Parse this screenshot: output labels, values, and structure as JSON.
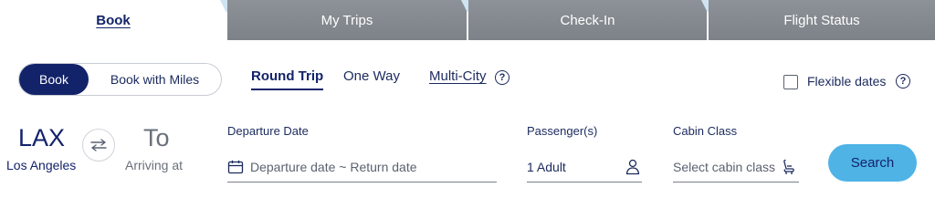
{
  "tabs": [
    {
      "label": "Book"
    },
    {
      "label": "My Trips"
    },
    {
      "label": "Check-In"
    },
    {
      "label": "Flight Status"
    }
  ],
  "toggle": {
    "book_label": "Book",
    "miles_label": "Book with Miles"
  },
  "trip_types": {
    "round_trip": "Round Trip",
    "one_way": "One Way",
    "multi_city": "Multi-City"
  },
  "help_glyph": "?",
  "flexible": {
    "label": "Flexible dates",
    "checked": false
  },
  "origin": {
    "code": "LAX",
    "city": "Los Angeles"
  },
  "destination": {
    "code": "To",
    "city": "Arriving at"
  },
  "departure": {
    "label": "Departure Date",
    "placeholder": "Departure date ~ Return date"
  },
  "passengers": {
    "label": "Passenger(s)",
    "value": "1 Adult"
  },
  "cabin": {
    "label": "Cabin Class",
    "placeholder": "Select cabin class"
  },
  "search": {
    "label": "Search"
  },
  "icons": {
    "swap": "swap-arrows-icon",
    "calendar": "calendar-icon",
    "person": "person-icon",
    "seat": "seat-icon",
    "help": "help-icon"
  },
  "colors": {
    "navy": "#13236a",
    "tab_grey": "#858a90",
    "search_blue": "#4fb3e6"
  }
}
